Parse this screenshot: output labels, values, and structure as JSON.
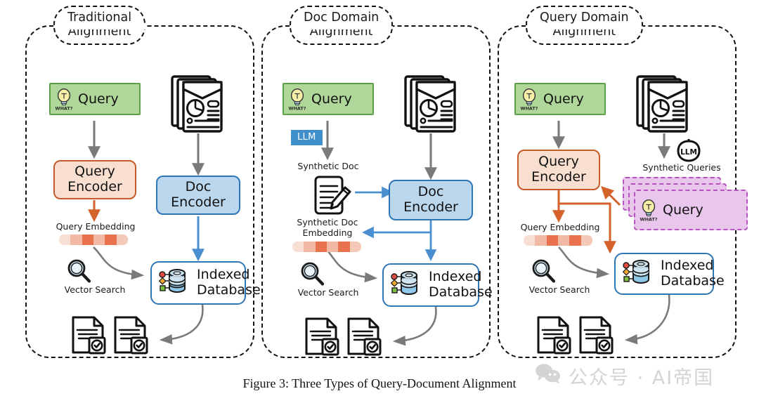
{
  "figure": {
    "caption": "Figure 3: Three Types of Query-Document Alignment",
    "watermark": "公众号 · AI帝国",
    "watermark_icon": "wechat-icon"
  },
  "colors": {
    "query_fill": "#AFD79A",
    "query_border": "#5E9E4A",
    "query_encoder_fill": "#F8DFD0",
    "query_encoder_border": "#C55A2B",
    "doc_encoder_fill": "#BBD7EE",
    "doc_encoder_border": "#2E75B6",
    "database_border": "#2E75B6",
    "synthetic_query_fill": "#E9C6EC",
    "synthetic_query_border": "#B452BE",
    "llm_badge_fill": "#3F8FCB",
    "gray_arrow": "#7A7A7A",
    "orange_arrow": "#D4622A",
    "blue_arrow": "#4A90D0",
    "embedding_segments": [
      "#F7DFD6",
      "#F2B9A4",
      "#E8714E",
      "#F2B9A4",
      "#E8714E",
      "#F4C9B8"
    ]
  },
  "panels": [
    {
      "id": "traditional",
      "title_line1": "Traditional",
      "title_line2": "Alignment",
      "query_label": "Query",
      "query_icon": "lightbulb-what-icon",
      "docs_icon": "document-stack-icon",
      "query_encoder_line1": "Query",
      "query_encoder_line2": "Encoder",
      "doc_encoder_line1": "Doc",
      "doc_encoder_line2": "Encoder",
      "embedding_label": "Query Embedding",
      "vector_search_label": "Vector Search",
      "vector_search_icon": "magnifier-icon",
      "database_line1": "Indexed",
      "database_line2": "Database",
      "database_icon": "database-cylinder-icon",
      "results_icon": "verified-documents-icon"
    },
    {
      "id": "doc-domain",
      "title_line1": "Doc Domain",
      "title_line2": "Alignment",
      "query_label": "Query",
      "query_icon": "lightbulb-what-icon",
      "docs_icon": "document-stack-icon",
      "llm_badge": "LLM",
      "synthetic_doc_label": "Synthetic Doc",
      "synthetic_doc_icon": "document-pencil-icon",
      "doc_encoder_line1": "Doc",
      "doc_encoder_line2": "Encoder",
      "embedding_label_line1": "Synthetic Doc",
      "embedding_label_line2": "Embedding",
      "vector_search_label": "Vector Search",
      "vector_search_icon": "magnifier-icon",
      "database_line1": "Indexed",
      "database_line2": "Database",
      "database_icon": "database-cylinder-icon",
      "results_icon": "verified-documents-icon"
    },
    {
      "id": "query-domain",
      "title_line1": "Query Domain",
      "title_line2": "Alignment",
      "query_label": "Query",
      "query_icon": "lightbulb-what-icon",
      "docs_icon": "document-stack-icon",
      "llm_badge": "LLM",
      "llm_icon": "llm-circle-icon",
      "synthetic_queries_label": "Synthetic Queries",
      "synthetic_query_label": "Query",
      "query_encoder_line1": "Query",
      "query_encoder_line2": "Encoder",
      "embedding_label": "Query Embedding",
      "vector_search_label": "Vector Search",
      "vector_search_icon": "magnifier-icon",
      "database_line1": "Indexed",
      "database_line2": "Database",
      "database_icon": "database-cylinder-icon",
      "results_icon": "verified-documents-icon"
    }
  ]
}
